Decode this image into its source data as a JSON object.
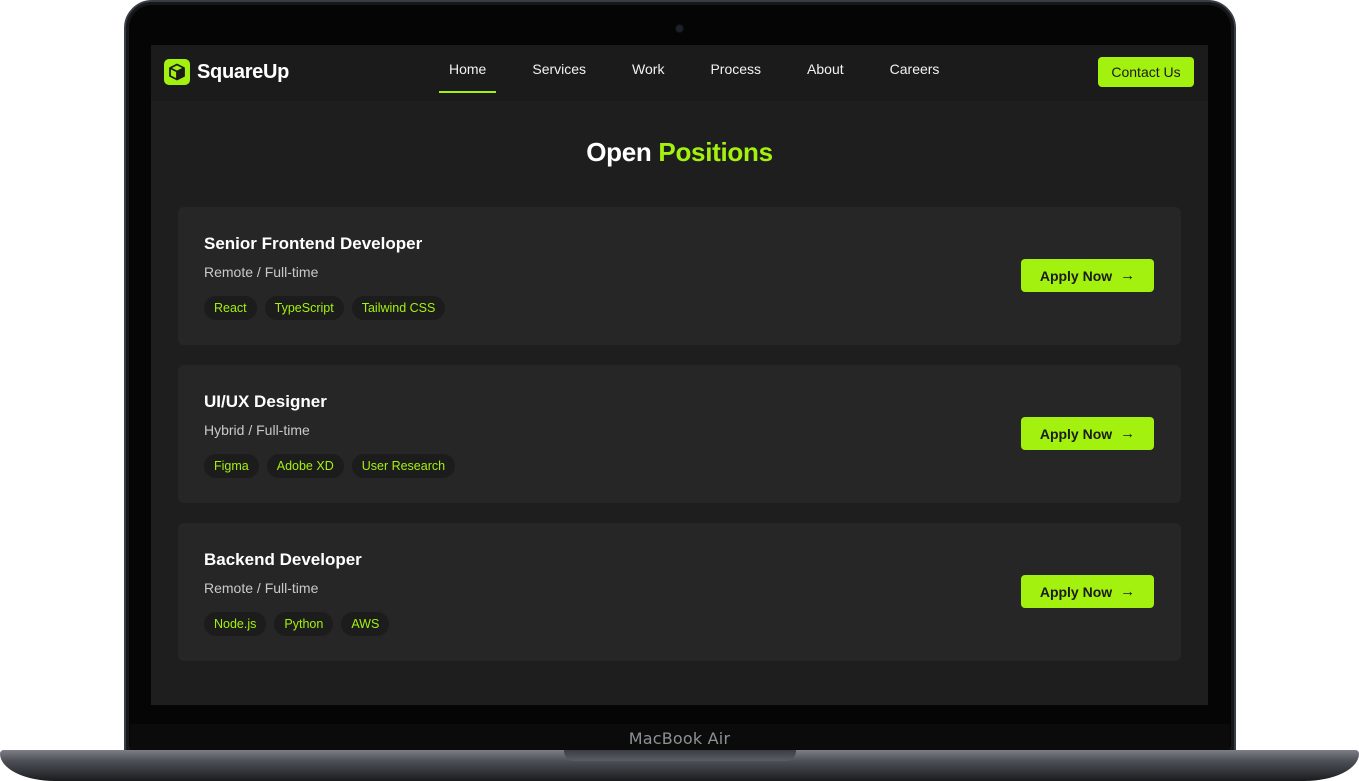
{
  "device": {
    "label": "MacBook Air"
  },
  "nav": {
    "brand": "SquareUp",
    "links": [
      "Home",
      "Services",
      "Work",
      "Process",
      "About",
      "Careers"
    ],
    "active": "Home",
    "contact_label": "Contact Us"
  },
  "heading": {
    "part1": "Open",
    "part2": "Positions"
  },
  "jobs": [
    {
      "title": "Senior Frontend Developer",
      "meta": "Remote / Full-time",
      "tags": [
        "React",
        "TypeScript",
        "Tailwind CSS"
      ],
      "apply_label": "Apply Now",
      "apply_icon": "→"
    },
    {
      "title": "UI/UX Designer",
      "meta": "Hybrid / Full-time",
      "tags": [
        "Figma",
        "Adobe XD",
        "User Research"
      ],
      "apply_label": "Apply Now",
      "apply_icon": "→"
    },
    {
      "title": "Backend Developer",
      "meta": "Remote / Full-time",
      "tags": [
        "Node.js",
        "Python",
        "AWS"
      ],
      "apply_label": "Apply Now",
      "apply_icon": "→"
    }
  ],
  "colors": {
    "accent": "#a3f10f",
    "background": "#1e1e1e",
    "card": "#262626",
    "nav": "#1b1b1b"
  },
  "icons": {
    "logo": "cube-icon",
    "apply": "arrow-right-icon"
  }
}
